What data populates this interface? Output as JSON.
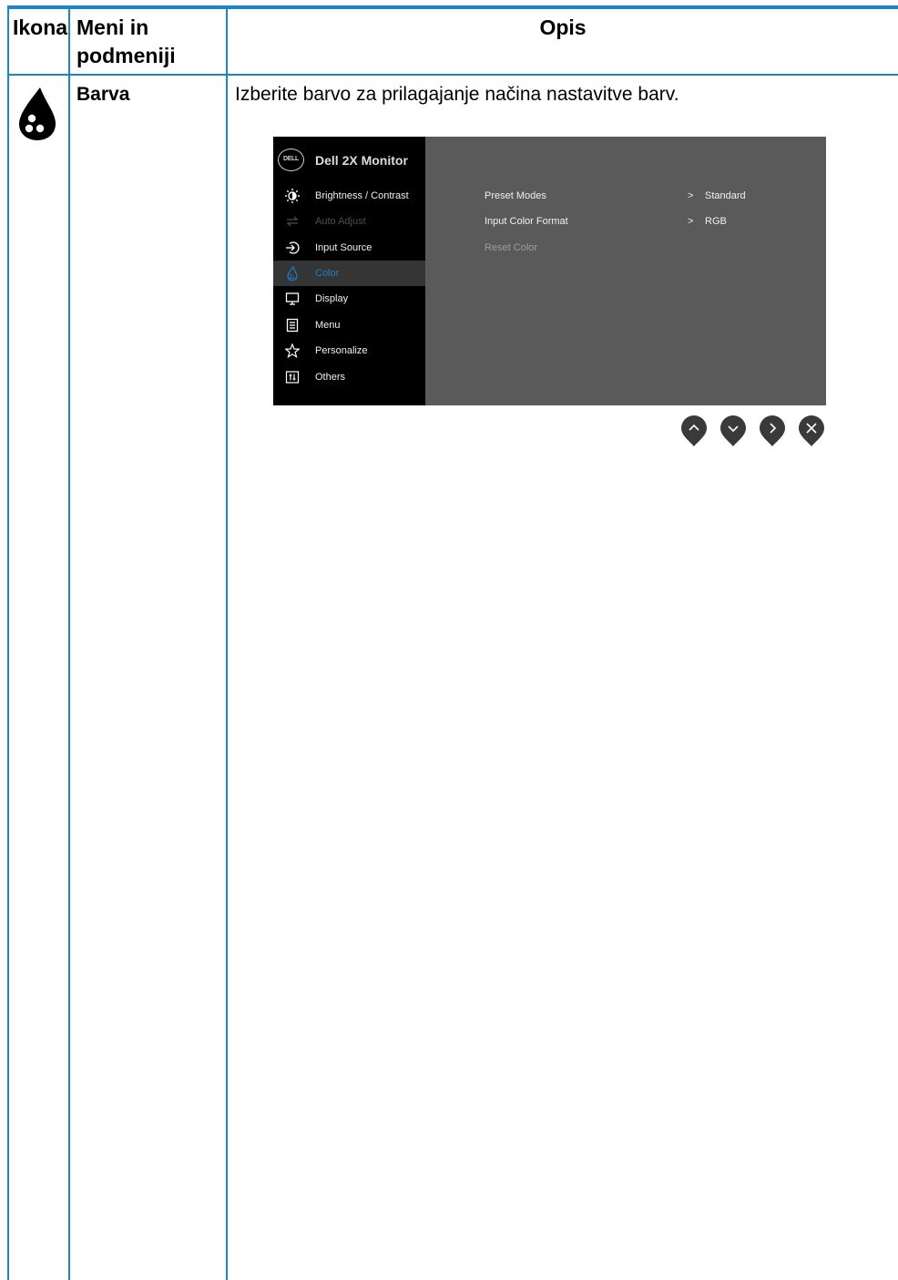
{
  "table": {
    "headers": {
      "icon": "Ikona",
      "menu": "Meni in podmeniji",
      "desc": "Opis"
    },
    "row": {
      "icon_name": "color-drop-icon",
      "menu": "Barva",
      "desc": "Izberite barvo za prilagajanje načina nastavitve barv."
    }
  },
  "osd": {
    "logo": "DELL",
    "title": "Dell 2X Monitor",
    "menu_items": [
      {
        "label": "Brightness / Contrast",
        "icon": "brightness-icon",
        "state": "normal"
      },
      {
        "label": "Auto Adjust",
        "icon": "auto-adjust-icon",
        "state": "disabled"
      },
      {
        "label": "Input Source",
        "icon": "input-source-icon",
        "state": "normal"
      },
      {
        "label": "Color",
        "icon": "color-icon",
        "state": "selected"
      },
      {
        "label": "Display",
        "icon": "display-icon",
        "state": "normal"
      },
      {
        "label": "Menu",
        "icon": "menu-icon",
        "state": "normal"
      },
      {
        "label": "Personalize",
        "icon": "star-icon",
        "state": "normal"
      },
      {
        "label": "Others",
        "icon": "others-icon",
        "state": "normal"
      }
    ],
    "submenu": [
      {
        "label": "Preset Modes",
        "arrow": ">",
        "value": "Standard"
      },
      {
        "label": "Input Color Format",
        "arrow": ">",
        "value": "RGB"
      },
      {
        "label": "Reset Color",
        "arrow": "",
        "value": ""
      }
    ],
    "nav_buttons": [
      "up-button",
      "down-button",
      "right-button",
      "close-button"
    ],
    "colors": {
      "accent": "#1a7fcf",
      "panel": "#5a5a5a",
      "sidebar": "#000000",
      "table_lines": "#1a86c8"
    }
  }
}
